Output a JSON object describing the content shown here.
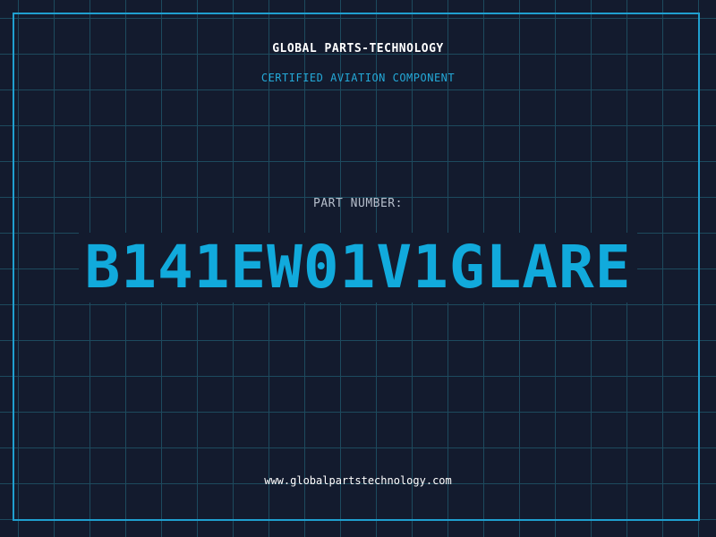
{
  "header": {
    "company_name": "GLOBAL PARTS-TECHNOLOGY",
    "subtitle": "CERTIFIED AVIATION COMPONENT"
  },
  "part": {
    "label": "PART NUMBER:",
    "number": "B141EW01V1GLARE"
  },
  "footer": {
    "website": "www.globalpartstechnology.com"
  },
  "colors": {
    "background": "#131b2e",
    "grid": "#1d4a5e",
    "frame": "#1f9fcf",
    "accent": "#11aadc",
    "subtitle": "#24a9d8",
    "label": "#b7bfcc",
    "text": "#ffffff"
  }
}
